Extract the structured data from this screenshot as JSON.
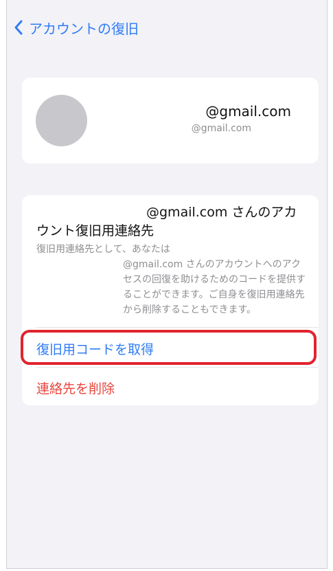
{
  "nav": {
    "back_label": "アカウントの復旧"
  },
  "account": {
    "email": "@gmail.com",
    "sub_email": "@gmail.com"
  },
  "contact": {
    "title": "@gmail.com さんのアカウント復旧用連絡先",
    "desc_line1": "復旧用連絡先として、あなたは",
    "desc_rest": "@gmail.com さんのアカウントへのアクセスの回復を助けるためのコードを提供することができます。ご自身を復旧用連絡先から削除することもできます。"
  },
  "actions": {
    "get_code": "復旧用コードを取得",
    "remove_contact": "連絡先を削除"
  },
  "colors": {
    "accent": "#2f7cf6",
    "destructive": "#e8453c",
    "highlight": "#e0242f",
    "background": "#f2f2f7"
  },
  "icons": {
    "back": "chevron-left-icon"
  }
}
